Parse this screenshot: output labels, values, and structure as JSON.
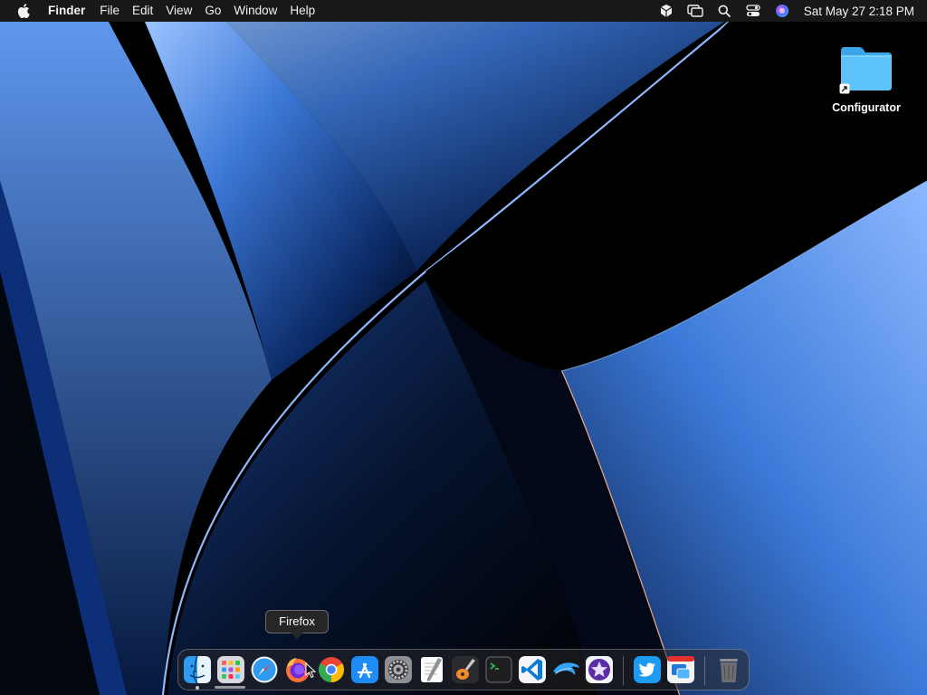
{
  "menubar": {
    "apple_icon": "apple-logo-icon",
    "app_name": "Finder",
    "items": [
      "File",
      "Edit",
      "View",
      "Go",
      "Window",
      "Help"
    ],
    "status_icons": [
      "cube-status-icon",
      "screen-mirroring-icon",
      "spotlight-search-icon",
      "control-center-icon",
      "siri-icon"
    ],
    "clock": "Sat May 27  2:18 PM"
  },
  "desktop": {
    "folder_label": "Configurator",
    "folder_icon": "folder-alias-icon"
  },
  "tooltip": {
    "label": "Firefox"
  },
  "dock": {
    "apps": [
      {
        "name": "Finder",
        "icon": "finder-icon",
        "running": true
      },
      {
        "name": "Launchpad",
        "icon": "launchpad-icon",
        "running": false
      },
      {
        "name": "Safari",
        "icon": "safari-icon",
        "running": false
      },
      {
        "name": "Firefox",
        "icon": "firefox-icon",
        "running": false
      },
      {
        "name": "Google Chrome",
        "icon": "chrome-icon",
        "running": false
      },
      {
        "name": "App Store",
        "icon": "app-store-icon",
        "running": false
      },
      {
        "name": "System Preferences",
        "icon": "system-preferences-icon",
        "running": false
      },
      {
        "name": "TextEdit",
        "icon": "textedit-icon",
        "running": false
      },
      {
        "name": "GarageBand",
        "icon": "garageband-icon",
        "running": false
      },
      {
        "name": "Terminal",
        "icon": "terminal-icon",
        "running": false
      },
      {
        "name": "Visual Studio Code",
        "icon": "vscode-icon",
        "running": false
      },
      {
        "name": "Dolphin",
        "icon": "dolphin-icon",
        "running": false
      },
      {
        "name": "iMovie",
        "icon": "imovie-icon",
        "running": false
      },
      {
        "name": "Twitter",
        "icon": "twitter-icon",
        "running": false
      },
      {
        "name": "Remote Desktop",
        "icon": "remote-desktop-icon",
        "running": false
      },
      {
        "name": "Trash",
        "icon": "trash-icon",
        "running": false
      }
    ]
  },
  "colors": {
    "wallpaper_blue": "#3a78e0",
    "menubar_bg": "#1c1c1e",
    "folder_blue": "#5ac8fa"
  }
}
